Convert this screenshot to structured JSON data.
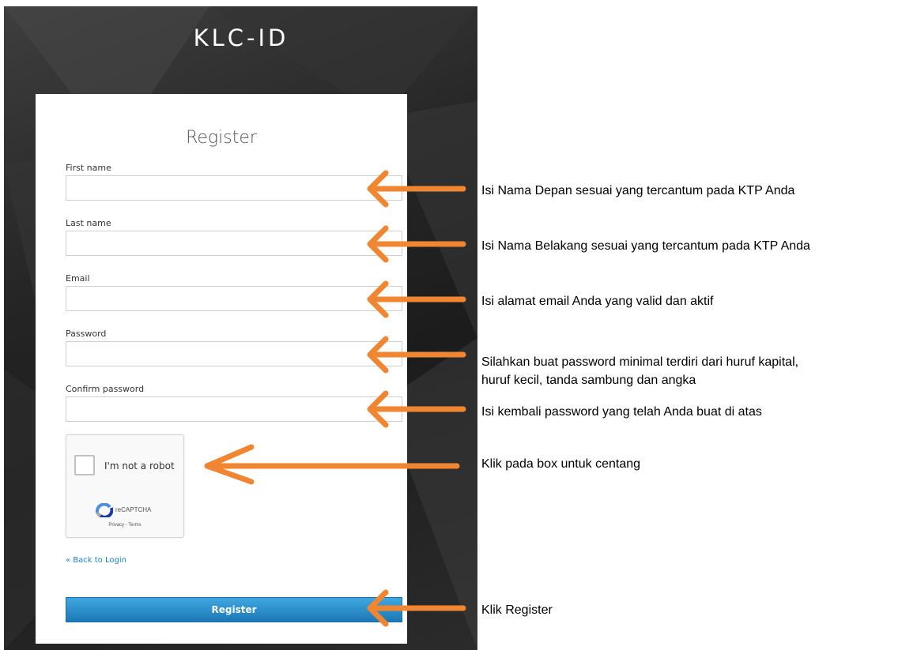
{
  "app_title": "KLC-ID",
  "form": {
    "title": "Register",
    "fields": [
      {
        "label": "First name",
        "value": ""
      },
      {
        "label": "Last name",
        "value": ""
      },
      {
        "label": "Email",
        "value": ""
      },
      {
        "label": "Password",
        "value": ""
      },
      {
        "label": "Confirm password",
        "value": ""
      }
    ],
    "captcha": {
      "label": "I'm not a robot",
      "brand": "reCAPTCHA",
      "links": "Privacy - Terms"
    },
    "back_link": "« Back to Login",
    "submit_label": "Register"
  },
  "annotations": [
    {
      "text": "Isi Nama Depan sesuai yang tercantum pada KTP Anda"
    },
    {
      "text": "Isi Nama Belakang sesuai yang tercantum pada KTP Anda"
    },
    {
      "text": "Isi alamat email Anda yang valid dan aktif"
    },
    {
      "line1": "Silahkan buat password minimal terdiri dari huruf kapital,",
      "line2": "huruf kecil, tanda sambung dan angka"
    },
    {
      "text": "Isi kembali password yang telah Anda buat di atas"
    },
    {
      "text": "Klik pada box untuk centang"
    },
    {
      "text": "Klik Register"
    }
  ],
  "colors": {
    "arrow": "#f08632",
    "button": "#2a8fcf",
    "link": "#1a84c7"
  }
}
